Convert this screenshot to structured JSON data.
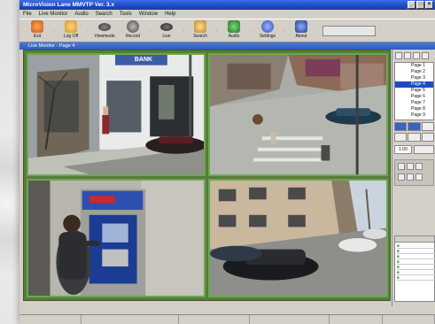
{
  "window": {
    "title": "MicroVision Lane MMVTP Ver. 3.x"
  },
  "menu": {
    "items": [
      "File",
      "Live Monitor",
      "Audio",
      "Search",
      "Tools",
      "Window",
      "Help"
    ]
  },
  "toolbar": {
    "buttons": [
      {
        "label": "Exit",
        "icon": "power-icon",
        "color": "#e07a2a"
      },
      {
        "label": "Log Off",
        "icon": "user-icon",
        "color": "#e0a83a"
      },
      {
        "label": "Viewmode",
        "icon": "camera-icon",
        "color": "#555555"
      },
      {
        "label": "Record",
        "icon": "record-icon",
        "color": "#666666"
      },
      {
        "label": "Live",
        "icon": "camera-icon",
        "color": "#444444"
      },
      {
        "label": "Search",
        "icon": "search-icon",
        "color": "#c8a23a"
      },
      {
        "label": "Audio",
        "icon": "audio-icon",
        "color": "#2f9c3a"
      },
      {
        "label": "Settings",
        "icon": "gear-icon",
        "color": "#3a62c8"
      },
      {
        "label": "About",
        "icon": "info-icon",
        "color": "#2a52b8"
      }
    ]
  },
  "subwindow": {
    "title": "Live Monitor - Page 4"
  },
  "cameras": [
    {
      "label": "BANK"
    },
    {
      "label": ""
    },
    {
      "label": ""
    },
    {
      "label": ""
    }
  ],
  "right_panel": {
    "pages": [
      "Page 1",
      "Page 2",
      "Page 3",
      "Page 4",
      "Page 5",
      "Page 6",
      "Page 7",
      "Page 8",
      "Page 9"
    ],
    "selected": "Page 4",
    "zoom": "1.00"
  },
  "colors": {
    "accent": "#1c4bc5",
    "frame": "#6aa84f"
  }
}
